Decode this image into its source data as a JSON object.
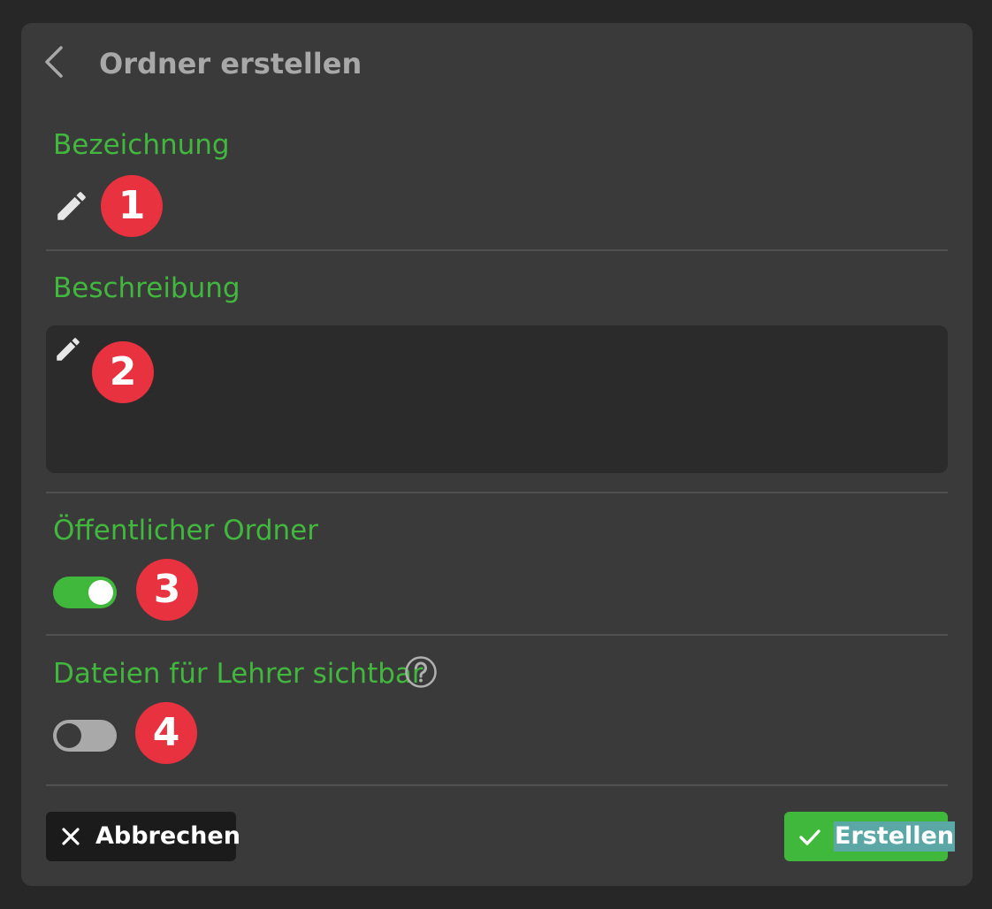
{
  "dialog": {
    "title": "Ordner erstellen"
  },
  "fields": {
    "name_label": "Bezeichnung",
    "name_value": "",
    "description_label": "Beschreibung",
    "description_value": "",
    "public_label": "Öffentlicher Ordner",
    "public_enabled": true,
    "teacher_visible_label": "Dateien für Lehrer sichtbar",
    "teacher_visible_enabled": false
  },
  "markers": [
    "1",
    "2",
    "3",
    "4"
  ],
  "buttons": {
    "cancel_label": "Abbrechen",
    "create_label": "Erstellen"
  },
  "icons": {
    "back": "chevron-left-icon",
    "edit": "pencil-icon",
    "help": "question-circle-icon",
    "cancel": "close-icon",
    "create": "checkmark-icon"
  },
  "colors": {
    "background": "#272727",
    "panel": "#3a3a3a",
    "accent_green": "#3fb83c",
    "label_green": "#41b83d",
    "marker_red": "#e8323f",
    "input_bg": "#2b2b2b",
    "cancel_bg": "#1b1b1b",
    "selection_highlight": "#5aa7a6"
  }
}
